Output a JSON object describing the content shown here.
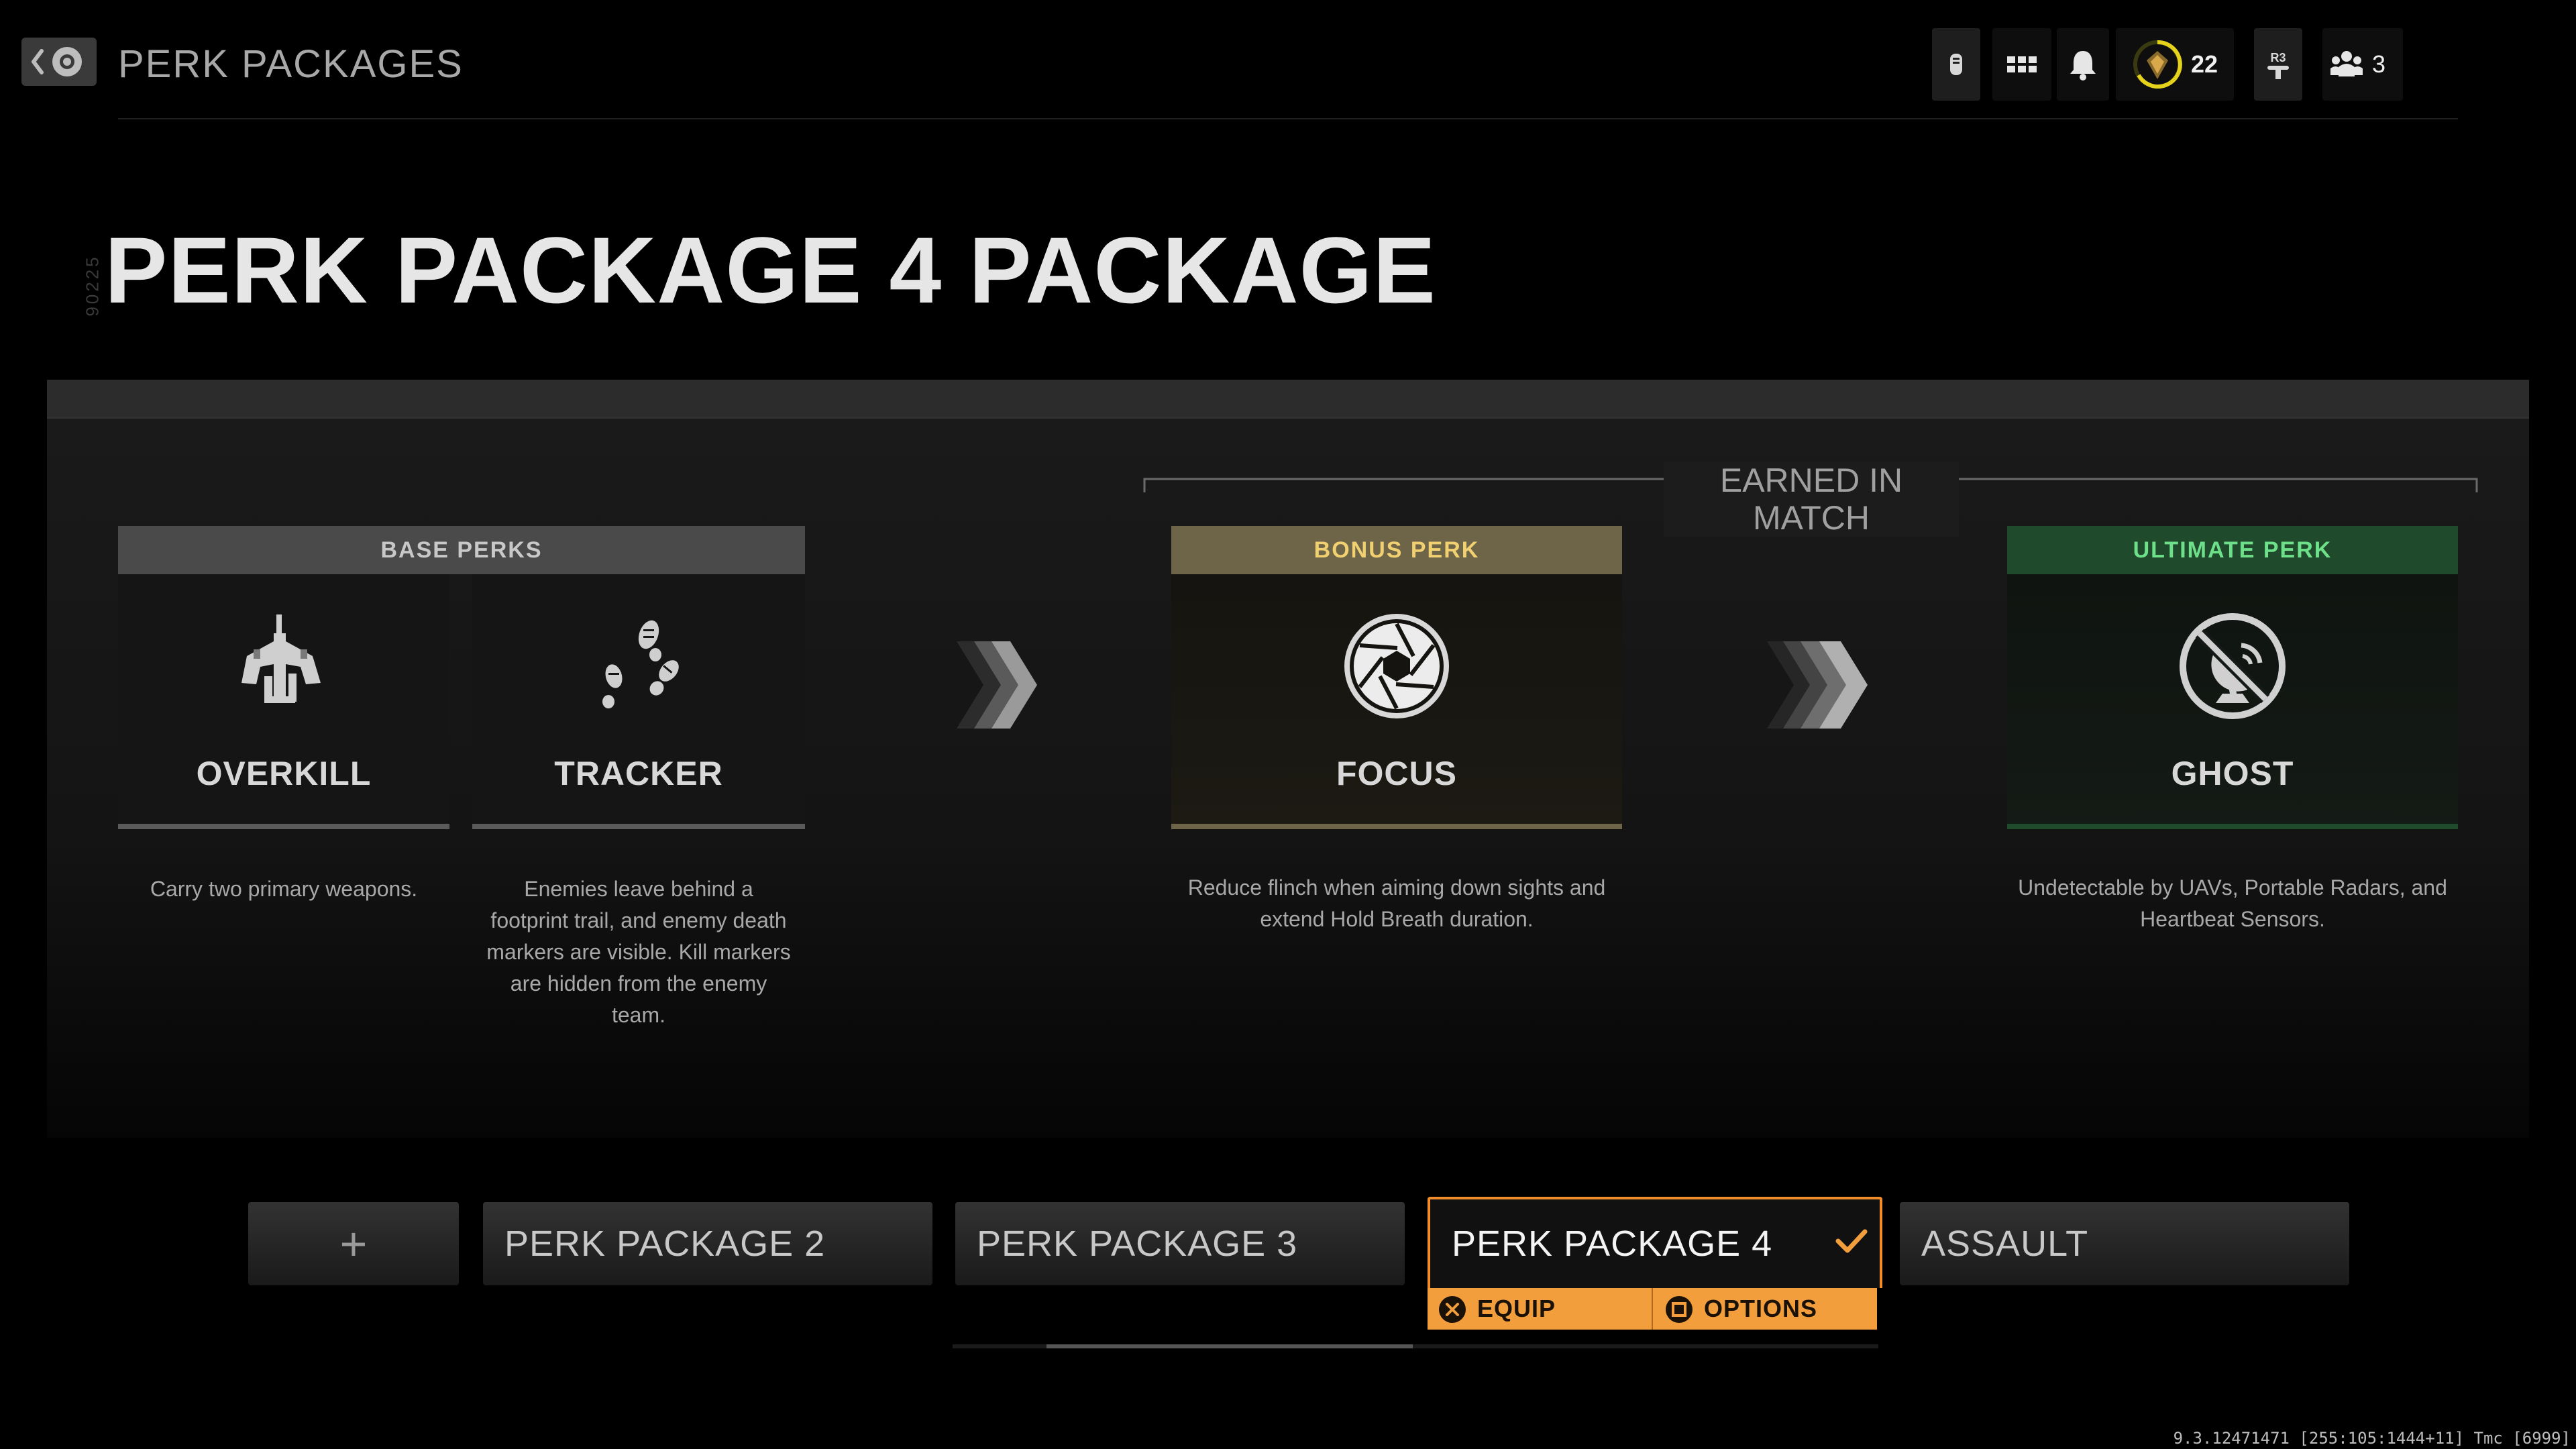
{
  "header": {
    "title": "PERK PACKAGES",
    "currency_count": "22",
    "party_count": "3",
    "r3_label": "R3"
  },
  "side_code": "90225",
  "page_title": "PERK PACKAGE 4 PACKAGE",
  "earned_in_match_label": "EARNED IN MATCH",
  "base_perks": {
    "header": "BASE PERKS",
    "items": [
      {
        "name": "OVERKILL",
        "icon": "overkill-weapons-icon",
        "description": "Carry two primary weapons."
      },
      {
        "name": "TRACKER",
        "icon": "footprints-icon",
        "description": "Enemies leave behind a footprint trail, and enemy death markers are visible. Kill markers are hidden from the enemy team."
      }
    ]
  },
  "bonus_perk": {
    "header": "BONUS PERK",
    "name": "FOCUS",
    "icon": "aperture-icon",
    "description": "Reduce flinch when aiming down sights and extend Hold Breath duration."
  },
  "ultimate_perk": {
    "header": "ULTIMATE PERK",
    "name": "GHOST",
    "icon": "no-radar-icon",
    "description": "Undetectable by UAVs, Portable Radars, and Heartbeat Sensors."
  },
  "packages": {
    "add_label": "+",
    "items": [
      "PERK PACKAGE 2",
      "PERK PACKAGE 3",
      "PERK PACKAGE 4",
      "ASSAULT"
    ],
    "selected": "PERK PACKAGE 4",
    "equip_label": "EQUIP",
    "options_label": "OPTIONS"
  },
  "build_info": "9.3.12471471 [255:105:1444+11] Tmc [6999]",
  "colors": {
    "accent_orange": "#f29e3c",
    "bonus_gold": "#f0d070",
    "ultimate_green": "#6ee08a"
  }
}
